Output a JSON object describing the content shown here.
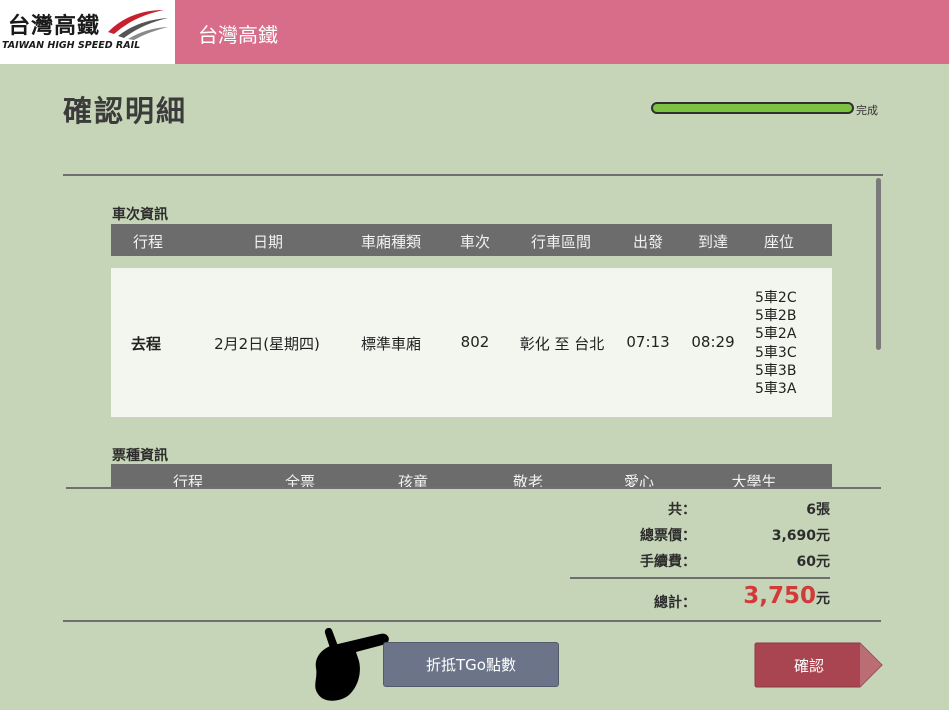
{
  "header": {
    "logo_text": "台灣高鐵",
    "logo_sub": "TAIWAN HIGH SPEED RAIL",
    "title": "台灣高鐵"
  },
  "page": {
    "title": "確認明細",
    "progress_label": "完成",
    "progress_fraction": 1.0
  },
  "train_info": {
    "section_label": "車次資訊",
    "columns": [
      "行程",
      "日期",
      "車廂種類",
      "車次",
      "行車區間",
      "出發",
      "到達",
      "座位"
    ],
    "row": {
      "trip": "去程",
      "date": "2月2日(星期四)",
      "car_type": "標準車廂",
      "train_no": "802",
      "route": "彰化 至 台北",
      "depart": "07:13",
      "arrive": "08:29",
      "seats": [
        "5車2C",
        "5車2B",
        "5車2A",
        "5車3C",
        "5車3B",
        "5車3A"
      ]
    }
  },
  "ticket_info": {
    "section_label": "票種資訊",
    "columns": [
      "行程",
      "全票",
      "孩童",
      "敬老",
      "愛心",
      "大學生"
    ]
  },
  "summary": {
    "count_label": "共：",
    "count_value": "6張",
    "fare_label": "總票價：",
    "fare_value": "3,690元",
    "fee_label": "手續費：",
    "fee_value": "60元",
    "total_label": "總計：",
    "total_number": "3,750",
    "total_unit": "元"
  },
  "buttons": {
    "tgo_label": "折抵TGo點數",
    "confirm_label": "確認"
  },
  "colors": {
    "header_pink": "#d76d88",
    "page_green": "#c6d5b8",
    "progress_green": "#7cc242",
    "total_red": "#d23a3a",
    "confirm_red": "#a84550",
    "tgo_slate": "#6b7488"
  },
  "icons": {
    "pointer": "pointing-hand-icon"
  }
}
